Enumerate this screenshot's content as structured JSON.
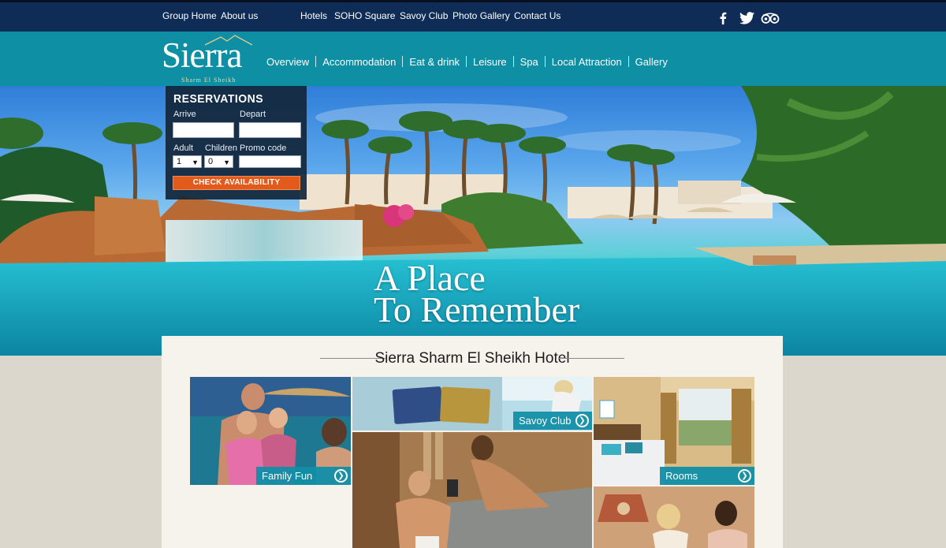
{
  "topbar": {
    "links_left": [
      "Group Home",
      "About us"
    ],
    "links_center": [
      "Hotels",
      "SOHO Square",
      "Savoy Club",
      "Photo Gallery",
      "Contact Us"
    ],
    "social_icons": [
      "facebook-icon",
      "twitter-icon",
      "tripadvisor-icon"
    ]
  },
  "logo": {
    "name": "Sierra",
    "subtitle": "Sharm El Sheikh"
  },
  "nav": [
    "Overview",
    "Accommodation",
    "Eat & drink",
    "Leisure",
    "Spa",
    "Local Attraction",
    "Gallery"
  ],
  "hero": {
    "line1": "A Place",
    "line2": "To Remember"
  },
  "reservations": {
    "title": "RESERVATIONS",
    "arrive_label": "Arrive",
    "depart_label": "Depart",
    "adult_label": "Adult",
    "children_label": "Children",
    "promo_label": "Promo code",
    "adult_value": "1",
    "children_value": "0",
    "check_button": "CHECK AVAILABILITY"
  },
  "content": {
    "title": "Sierra Sharm El Sheikh Hotel",
    "tiles": [
      "Family Fun",
      "Savoy Club",
      "Rooms"
    ],
    "card_text": "SAVOY CLUB"
  },
  "colors": {
    "topbar": "#0e2c55",
    "nav": "#0e8fa3",
    "accent_button": "#e35b1c",
    "tile_label": "#118ea8"
  }
}
